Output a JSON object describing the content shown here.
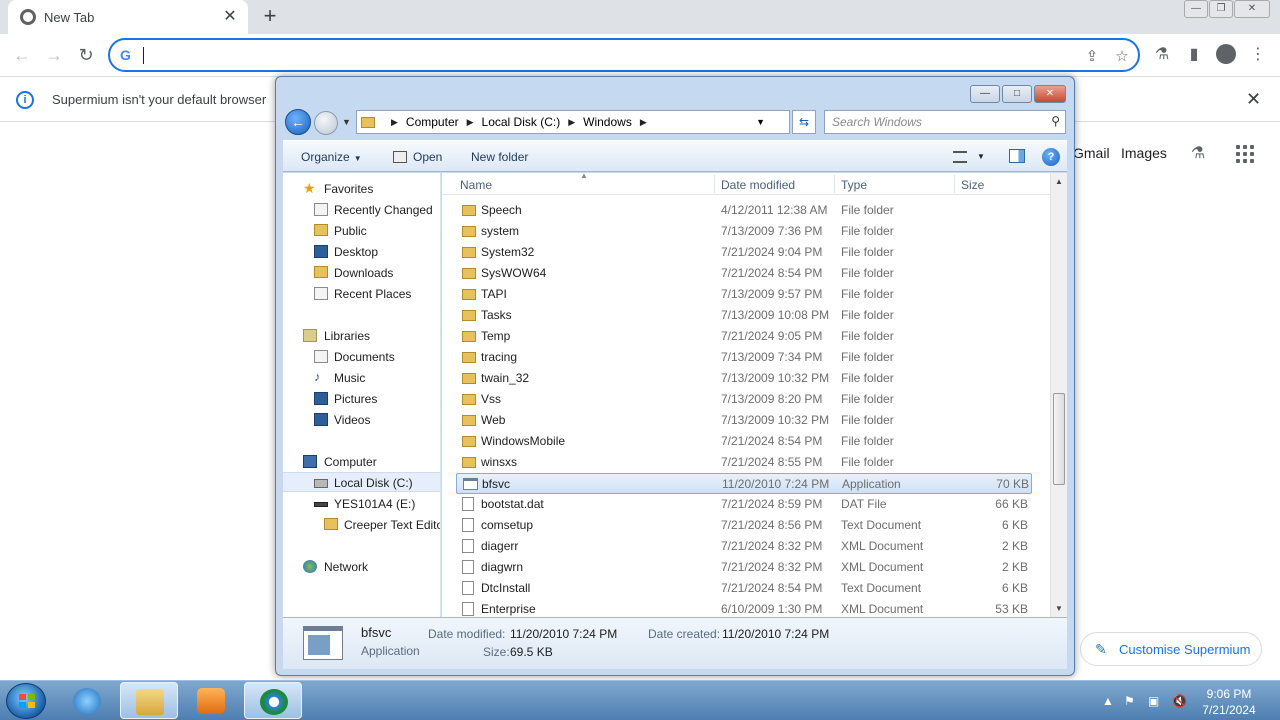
{
  "browser": {
    "tab_title": "New Tab",
    "omnibox_placeholder": "",
    "infobar_message": "Supermium isn't your default browser",
    "ntp_links": [
      "Gmail",
      "Images"
    ],
    "customise_label": "Customise Supermium"
  },
  "explorer": {
    "breadcrumb": [
      "Computer",
      "Local Disk (C:)",
      "Windows"
    ],
    "search_placeholder": "Search Windows",
    "commands": {
      "organize": "Organize",
      "open": "Open",
      "new_folder": "New folder"
    },
    "columns": {
      "name": "Name",
      "date": "Date modified",
      "type": "Type",
      "size": "Size"
    },
    "nav": {
      "favorites": "Favorites",
      "fav_items": [
        "Recently Changed",
        "Public",
        "Desktop",
        "Downloads",
        "Recent Places"
      ],
      "libraries": "Libraries",
      "lib_items": [
        "Documents",
        "Music",
        "Pictures",
        "Videos"
      ],
      "computer": "Computer",
      "local_disk": "Local Disk (C:)",
      "usb": "YES101A4 (E:)",
      "usb_folder": "Creeper Text Edito",
      "network": "Network"
    },
    "files": [
      {
        "name": "Speech",
        "date": "4/12/2011 12:38 AM",
        "type": "File folder",
        "size": "",
        "icon": "folder-icon"
      },
      {
        "name": "system",
        "date": "7/13/2009 7:36 PM",
        "type": "File folder",
        "size": "",
        "icon": "folder-icon"
      },
      {
        "name": "System32",
        "date": "7/21/2024 9:04 PM",
        "type": "File folder",
        "size": "",
        "icon": "folder-icon"
      },
      {
        "name": "SysWOW64",
        "date": "7/21/2024 8:54 PM",
        "type": "File folder",
        "size": "",
        "icon": "folder-icon"
      },
      {
        "name": "TAPI",
        "date": "7/13/2009 9:57 PM",
        "type": "File folder",
        "size": "",
        "icon": "folder-icon"
      },
      {
        "name": "Tasks",
        "date": "7/13/2009 10:08 PM",
        "type": "File folder",
        "size": "",
        "icon": "folder-icon"
      },
      {
        "name": "Temp",
        "date": "7/21/2024 9:05 PM",
        "type": "File folder",
        "size": "",
        "icon": "folder-icon"
      },
      {
        "name": "tracing",
        "date": "7/13/2009 7:34 PM",
        "type": "File folder",
        "size": "",
        "icon": "folder-icon"
      },
      {
        "name": "twain_32",
        "date": "7/13/2009 10:32 PM",
        "type": "File folder",
        "size": "",
        "icon": "folder-icon"
      },
      {
        "name": "Vss",
        "date": "7/13/2009 8:20 PM",
        "type": "File folder",
        "size": "",
        "icon": "folder-icon"
      },
      {
        "name": "Web",
        "date": "7/13/2009 10:32 PM",
        "type": "File folder",
        "size": "",
        "icon": "folder-icon"
      },
      {
        "name": "WindowsMobile",
        "date": "7/21/2024 8:54 PM",
        "type": "File folder",
        "size": "",
        "icon": "folder-icon"
      },
      {
        "name": "winsxs",
        "date": "7/21/2024 8:55 PM",
        "type": "File folder",
        "size": "",
        "icon": "folder-icon"
      },
      {
        "name": "bfsvc",
        "date": "11/20/2010 7:24 PM",
        "type": "Application",
        "size": "70 KB",
        "icon": "application-icon",
        "selected": true
      },
      {
        "name": "bootstat.dat",
        "date": "7/21/2024 8:59 PM",
        "type": "DAT File",
        "size": "66 KB",
        "icon": "file-icon"
      },
      {
        "name": "comsetup",
        "date": "7/21/2024 8:56 PM",
        "type": "Text Document",
        "size": "6 KB",
        "icon": "file-icon"
      },
      {
        "name": "diagerr",
        "date": "7/21/2024 8:32 PM",
        "type": "XML Document",
        "size": "2 KB",
        "icon": "xml-file-icon"
      },
      {
        "name": "diagwrn",
        "date": "7/21/2024 8:32 PM",
        "type": "XML Document",
        "size": "2 KB",
        "icon": "xml-file-icon"
      },
      {
        "name": "DtcInstall",
        "date": "7/21/2024 8:54 PM",
        "type": "Text Document",
        "size": "6 KB",
        "icon": "file-icon"
      },
      {
        "name": "Enterprise",
        "date": "6/10/2009 1:30 PM",
        "type": "XML Document",
        "size": "53 KB",
        "icon": "xml-file-icon"
      }
    ],
    "details": {
      "name": "bfsvc",
      "type": "Application",
      "modified_label": "Date modified:",
      "modified": "11/20/2010 7:24 PM",
      "created_label": "Date created:",
      "created": "11/20/2010 7:24 PM",
      "size_label": "Size:",
      "size": "69.5 KB"
    }
  },
  "taskbar": {
    "time": "9:06 PM",
    "date": "7/21/2024"
  },
  "colors": {
    "chrome_accent": "#1a73e8",
    "selection": "#cfe1f7",
    "taskbar": "#4e7fb0"
  }
}
